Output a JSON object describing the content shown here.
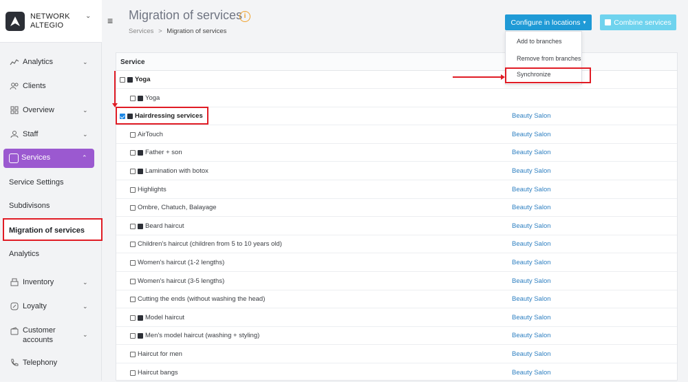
{
  "brand": {
    "name": "NETWORK ALTEGIO"
  },
  "header": {
    "title": "Migration of services",
    "breadcrumb": {
      "parent": "Services",
      "separator": ">",
      "current": "Migration of services"
    },
    "configure_button": "Configure in locations",
    "combine_button": "Combine services"
  },
  "dropdown": {
    "items": [
      "Add to branches",
      "Remove from branches",
      "Synchronize"
    ]
  },
  "sidebar": {
    "items": [
      {
        "label": "Analytics"
      },
      {
        "label": "Clients"
      },
      {
        "label": "Overview"
      },
      {
        "label": "Staff"
      },
      {
        "label": "Services"
      },
      {
        "label": "Service Settings"
      },
      {
        "label": "Subdivisons"
      },
      {
        "label": "Migration of services"
      },
      {
        "label": "Analytics"
      },
      {
        "label": "Inventory"
      },
      {
        "label": "Loyalty"
      },
      {
        "label": "Customer accounts"
      },
      {
        "label": "Telephony"
      }
    ]
  },
  "table": {
    "header": "Service",
    "rows": [
      {
        "label": "Yoga",
        "checked": false,
        "shared": true,
        "group": true,
        "location": ""
      },
      {
        "label": "Yoga",
        "checked": false,
        "shared": true,
        "group": false,
        "location": ""
      },
      {
        "label": "Hairdressing services",
        "checked": true,
        "shared": true,
        "group": true,
        "location": "Beauty Salon"
      },
      {
        "label": "AirTouch",
        "checked": false,
        "shared": false,
        "group": false,
        "location": "Beauty Salon"
      },
      {
        "label": "Father + son",
        "checked": false,
        "shared": true,
        "group": false,
        "location": "Beauty Salon"
      },
      {
        "label": "Lamination with botox",
        "checked": false,
        "shared": true,
        "group": false,
        "location": "Beauty Salon"
      },
      {
        "label": "Highlights",
        "checked": false,
        "shared": false,
        "group": false,
        "location": "Beauty Salon"
      },
      {
        "label": "Ombre, Chatuch, Balayage",
        "checked": false,
        "shared": false,
        "group": false,
        "location": "Beauty Salon"
      },
      {
        "label": "Beard haircut",
        "checked": false,
        "shared": true,
        "group": false,
        "location": "Beauty Salon"
      },
      {
        "label": "Children's haircut (children from 5 to 10 years old)",
        "checked": false,
        "shared": false,
        "group": false,
        "location": "Beauty Salon"
      },
      {
        "label": "Women's haircut (1-2 lengths)",
        "checked": false,
        "shared": false,
        "group": false,
        "location": "Beauty Salon"
      },
      {
        "label": "Women's haircut (3-5 lengths)",
        "checked": false,
        "shared": false,
        "group": false,
        "location": "Beauty Salon"
      },
      {
        "label": "Cutting the ends (without washing the head)",
        "checked": false,
        "shared": false,
        "group": false,
        "location": "Beauty Salon"
      },
      {
        "label": "Model haircut",
        "checked": false,
        "shared": true,
        "group": false,
        "location": "Beauty Salon"
      },
      {
        "label": "Men's model haircut (washing + styling)",
        "checked": false,
        "shared": true,
        "group": false,
        "location": "Beauty Salon"
      },
      {
        "label": "Haircut for men",
        "checked": false,
        "shared": false,
        "group": false,
        "location": "Beauty Salon"
      },
      {
        "label": "Haircut bangs",
        "checked": false,
        "shared": false,
        "group": false,
        "location": "Beauty Salon"
      }
    ]
  }
}
